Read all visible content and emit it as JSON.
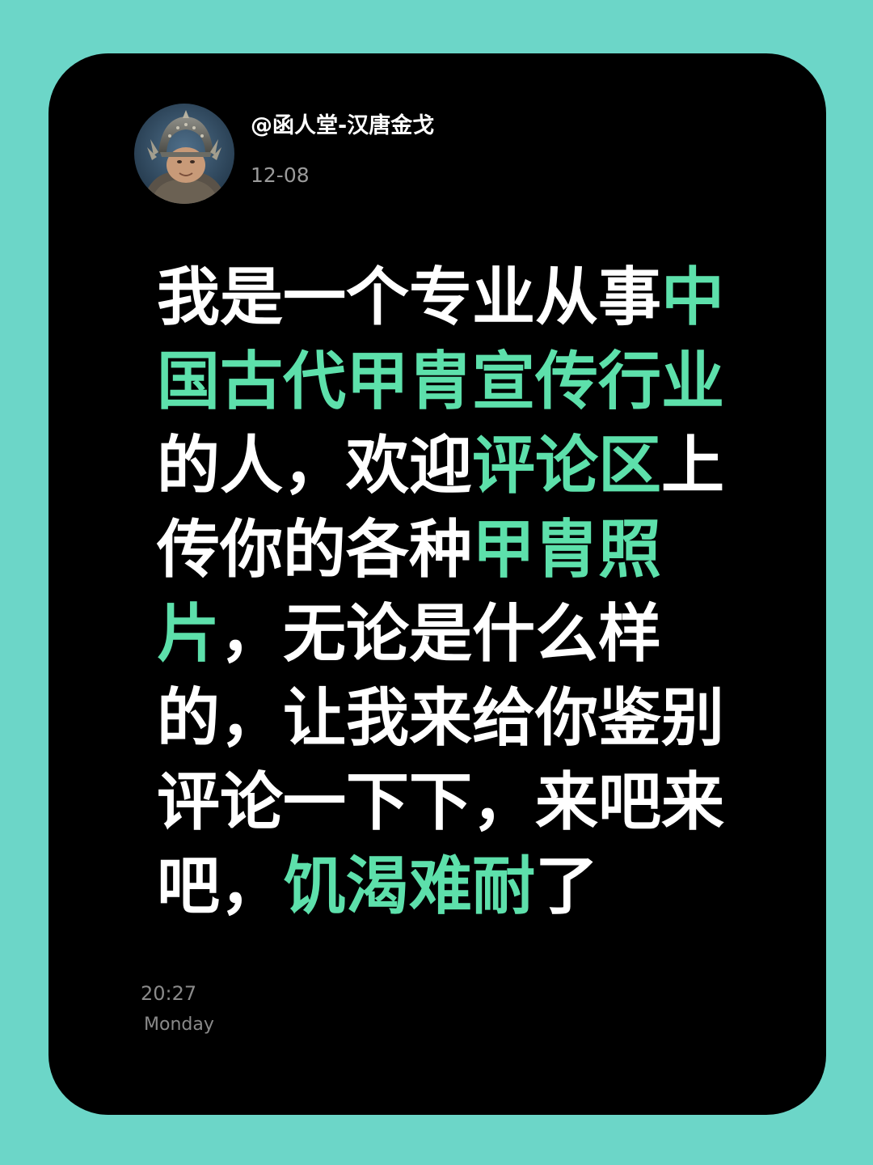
{
  "author": {
    "username": "@函人堂-汉唐金戈",
    "date": "12-08",
    "avatar": "armored-warrior-avatar"
  },
  "post": {
    "lines": [
      [
        {
          "t": "我是一个专业从事",
          "h": false
        },
        {
          "t": "中",
          "h": true
        }
      ],
      [
        {
          "t": "国古代甲胄宣传行业",
          "h": true
        }
      ],
      [
        {
          "t": "的人，欢迎",
          "h": false
        },
        {
          "t": "评论区",
          "h": true
        },
        {
          "t": "上",
          "h": false
        }
      ],
      [
        {
          "t": "传你的各种",
          "h": false
        },
        {
          "t": "甲胄照",
          "h": true
        }
      ],
      [
        {
          "t": "片",
          "h": true
        },
        {
          "t": "，无论是什么样",
          "h": false
        }
      ],
      [
        {
          "t": "的，让我来给你鉴别",
          "h": false
        }
      ],
      [
        {
          "t": "评论一下下，来吧来",
          "h": false
        }
      ],
      [
        {
          "t": "吧，",
          "h": false
        },
        {
          "t": "饥渴难耐",
          "h": true
        },
        {
          "t": "了",
          "h": false
        }
      ]
    ]
  },
  "footer": {
    "time": "20:27",
    "weekday": "Monday"
  },
  "colors": {
    "background": "#6cd6c8",
    "card": "#000000",
    "highlight": "#5de0ab",
    "text": "#ffffff",
    "muted": "#8a8a8a"
  }
}
